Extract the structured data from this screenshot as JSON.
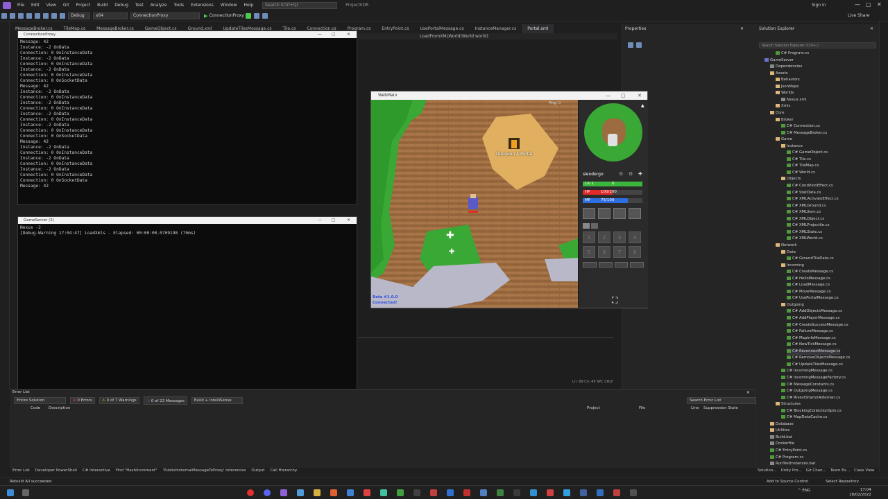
{
  "menubar": {
    "items": [
      "File",
      "Edit",
      "View",
      "Git",
      "Project",
      "Build",
      "Debug",
      "Test",
      "Analyze",
      "Tools",
      "Extensions",
      "Window",
      "Help"
    ],
    "search_placeholder": "Search (Ctrl+Q)",
    "project_name": "ProjectSDR",
    "signin": "Sign in",
    "live_share": "Live Share"
  },
  "toolbar": {
    "config": "Debug",
    "platform": "x64",
    "startup": "ConnectionProxy",
    "run_label": "ConnectionProxy"
  },
  "editor": {
    "tabs": [
      "MessageBroker.cs",
      "TileMap.cs",
      "MessageBroker.cs",
      "GameObject.cs",
      "Ground.xml",
      "UpdateTilesMessage.cs",
      "Tile.cs",
      "Connection.cs",
      "Program.cs",
      "EntryPoint.cs",
      "UsePortalMessage.cs",
      "InstanceManager.cs",
      "Portal.xml"
    ],
    "nav_member": "LoadFromXMLWorld(World world)",
    "status": "Ln: 89   Ch: 49   SPC   CRLF"
  },
  "console1": {
    "title": "ConnectionProxy",
    "lines": [
      "Message: 42",
      "Instance: -2 OnData",
      "Connection: 0 OnInstanceData",
      "Instance: -2 OnData",
      "Connection: 0 OnInstanceData",
      "Instance: -2 OnData",
      "Connection: 0 OnInstanceData",
      "Connection: 0 OnSocketData",
      "Message: 42",
      "Instance: -2 OnData",
      "Connection: 0 OnInstanceData",
      "Instance: -2 OnData",
      "Connection: 0 OnInstanceData",
      "Instance: -2 OnData",
      "Connection: 0 OnInstanceData",
      "Instance: -2 OnData",
      "Connection: 0 OnInstanceData",
      "Connection: 0 OnSocketData",
      "Message: 42",
      "Instance: -2 OnData",
      "Connection: 0 OnInstanceData",
      "Instance: -2 OnData",
      "Connection: 0 OnInstanceData",
      "Instance: -2 OnData",
      "Connection: 0 OnInstanceData",
      "Connection: 0 OnSocketData",
      "Message: 42"
    ]
  },
  "console2": {
    "title": "GameServer (2)",
    "lines": [
      "Nexus -2",
      "[Debug-Warning 17:04:47] LoadXmls - Elapsed: 00:00:00.0709198 (70ms)"
    ]
  },
  "game": {
    "title": "WebMain",
    "portal_label": "Dungeon A Portal",
    "ping": "Ping: 0",
    "version": "Beta #1.0.0",
    "connection": "Connected!",
    "player_name": "slendergo",
    "level": "Lvl 1",
    "level_value": "0",
    "hp_label": "HP",
    "hp_value": "100/200",
    "hp_fraction": 0.5,
    "mp_label": "MP",
    "mp_value": "75/100",
    "mp_fraction": 0.75,
    "inventory_slots": [
      "1",
      "2",
      "3",
      "4",
      "5",
      "6",
      "7",
      "8"
    ],
    "colors": {
      "hp": "#e02b2b",
      "mp": "#2d6fe0",
      "xp": "#3bb53b",
      "grass": "#3aa835",
      "floor": "#9c6b3f",
      "stone": "#b8b8c8"
    }
  },
  "properties": {
    "title": "Properties"
  },
  "solution_explorer": {
    "title": "Solution Explorer",
    "search_placeholder": "Search Solution Explorer (Ctrl+;)",
    "items": [
      {
        "label": "C# Program.cs",
        "type": "cs"
      },
      {
        "label": "GameServer",
        "type": "proj"
      },
      {
        "label": "Dependencies",
        "type": "file"
      },
      {
        "label": "Assets",
        "type": "folder"
      },
      {
        "label": "Behaviors",
        "type": "folder"
      },
      {
        "label": "JsonMaps",
        "type": "folder"
      },
      {
        "label": "Worlds",
        "type": "folder"
      },
      {
        "label": "Nexus.xml",
        "type": "file"
      },
      {
        "label": "Xmls",
        "type": "folder"
      },
      {
        "label": "Core",
        "type": "folder"
      },
      {
        "label": "Broker",
        "type": "folder"
      },
      {
        "label": "C# Connection.cs",
        "type": "cs"
      },
      {
        "label": "C# MessageBroker.cs",
        "type": "cs"
      },
      {
        "label": "Game",
        "type": "folder"
      },
      {
        "label": "Instance",
        "type": "folder"
      },
      {
        "label": "C# GameObject.cs",
        "type": "cs"
      },
      {
        "label": "C# Tile.cs",
        "type": "cs"
      },
      {
        "label": "C# TileMap.cs",
        "type": "cs"
      },
      {
        "label": "C# World.cs",
        "type": "cs"
      },
      {
        "label": "Objects",
        "type": "folder"
      },
      {
        "label": "C# ConditionEffect.cs",
        "type": "cs"
      },
      {
        "label": "C# StatData.cs",
        "type": "cs"
      },
      {
        "label": "C# XMLActivateEffect.cs",
        "type": "cs"
      },
      {
        "label": "C# XMLGround.cs",
        "type": "cs"
      },
      {
        "label": "C# XMLItem.cs",
        "type": "cs"
      },
      {
        "label": "C# XMLObject.cs",
        "type": "cs"
      },
      {
        "label": "C# XMLProjectile.cs",
        "type": "cs"
      },
      {
        "label": "C# XMLState.cs",
        "type": "cs"
      },
      {
        "label": "C# XMLWorld.cs",
        "type": "cs"
      },
      {
        "label": "Network",
        "type": "folder"
      },
      {
        "label": "Data",
        "type": "folder"
      },
      {
        "label": "C# GroundTileData.cs",
        "type": "cs"
      },
      {
        "label": "Incoming",
        "type": "folder"
      },
      {
        "label": "C# CreateMessage.cs",
        "type": "cs"
      },
      {
        "label": "C# HelloMessage.cs",
        "type": "cs"
      },
      {
        "label": "C# LoadMessage.cs",
        "type": "cs"
      },
      {
        "label": "C# MoveMessage.cs",
        "type": "cs"
      },
      {
        "label": "C# UsePortalMessage.cs",
        "type": "cs"
      },
      {
        "label": "Outgoing",
        "type": "folder"
      },
      {
        "label": "C# AddObjectsMessage.cs",
        "type": "cs"
      },
      {
        "label": "C# AddPlayerMessage.cs",
        "type": "cs"
      },
      {
        "label": "C# CreateSuccessMessage.cs",
        "type": "cs"
      },
      {
        "label": "C# FailureMessage.cs",
        "type": "cs"
      },
      {
        "label": "C# MapInfoMessage.cs",
        "type": "cs"
      },
      {
        "label": "C# NewTickMessage.cs",
        "type": "cs"
      },
      {
        "label": "C# ReconnectMessage.cs",
        "type": "cs"
      },
      {
        "label": "C# RemoveObjectsMessage.cs",
        "type": "cs"
      },
      {
        "label": "C# UpdateTilesMessage.cs",
        "type": "cs"
      },
      {
        "label": "C# IncomingMessage.cs",
        "type": "cs"
      },
      {
        "label": "C# IncomingMessageFactory.cs",
        "type": "cs"
      },
      {
        "label": "C# MessageConstants.cs",
        "type": "cs"
      },
      {
        "label": "C# OutgoingMessage.cs",
        "type": "cs"
      },
      {
        "label": "C# RivestShamirAdleman.cs",
        "type": "cs"
      },
      {
        "label": "Structures",
        "type": "folder"
      },
      {
        "label": "C# BlockingCollectionSpin.cs",
        "type": "cs"
      },
      {
        "label": "C# MapDataCache.cs",
        "type": "cs"
      },
      {
        "label": "Database",
        "type": "folder"
      },
      {
        "label": "Utilities",
        "type": "folder"
      },
      {
        "label": "Build.bat",
        "type": "file"
      },
      {
        "label": "Dockerfile",
        "type": "file"
      },
      {
        "label": "C# EntryPoint.cs",
        "type": "cs"
      },
      {
        "label": "C# Program.cs",
        "type": "cs"
      },
      {
        "label": "RunTestInstances.bat",
        "type": "file"
      }
    ]
  },
  "error_list": {
    "title": "Error List",
    "scope": "Entire Solution",
    "errors": "0 Errors",
    "warnings": "0 of 7 Warnings",
    "messages": "0 of 22 Messages",
    "build_filter": "Build + IntelliSense",
    "search_placeholder": "Search Error List",
    "columns": {
      "code": "Code",
      "description": "Description",
      "project": "Project",
      "file": "File",
      "line": "Line",
      "suppression": "Suppression State"
    }
  },
  "bottom_tabs": [
    "Error List",
    "Developer PowerShell",
    "C# Interactive",
    "Find \"HashIncrement\"",
    "'PublishInternalMessageToProxy' references",
    "Output",
    "Call Hierarchy"
  ],
  "sol_tabs": [
    "Solution...",
    "Unity Pro...",
    "Git Chan...",
    "Team Ex...",
    "Class View"
  ],
  "statusbar": {
    "message": "Rebuild All succeeded",
    "source_control": "Add to Source Control",
    "repo": "Select Repository"
  },
  "taskbar": {
    "lang": "ENG",
    "time": "17:04",
    "date": "18/02/2022"
  }
}
